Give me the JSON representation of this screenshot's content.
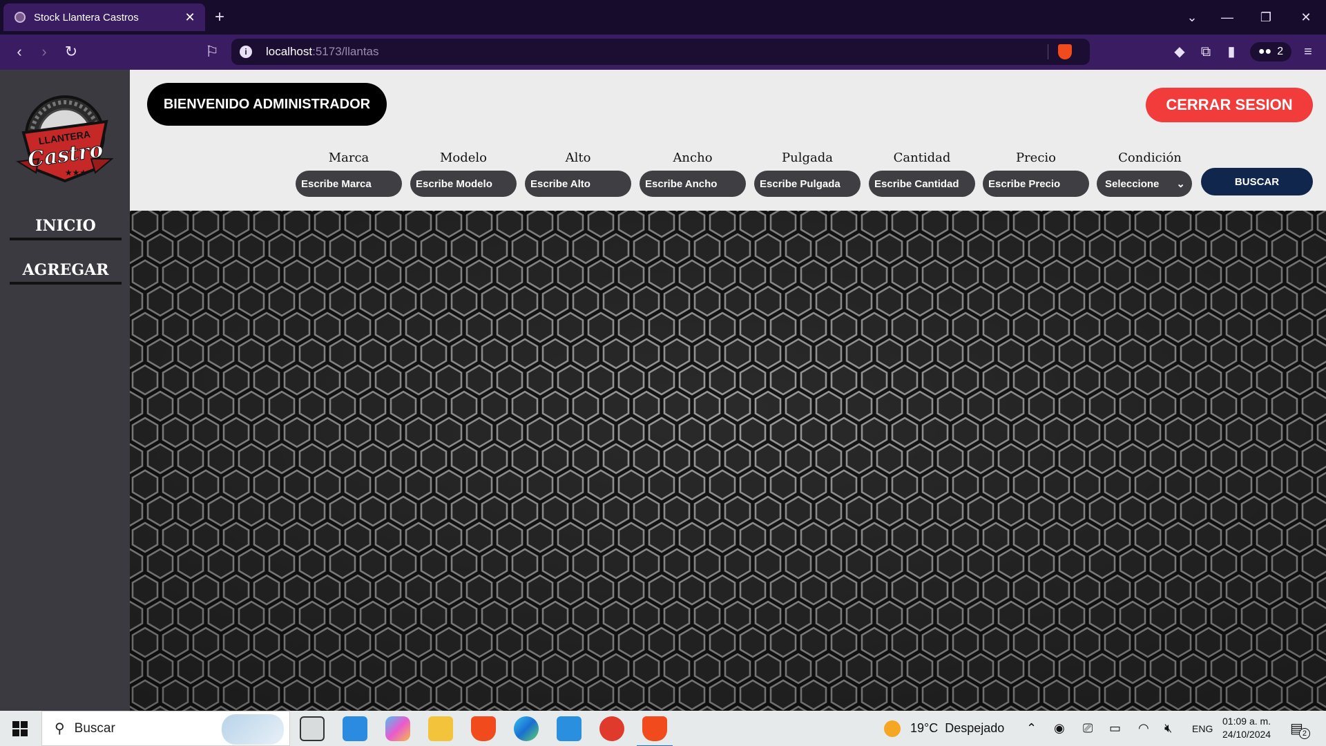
{
  "browser": {
    "tab_title": "Stock Llantera Castros",
    "tab_close": "✕",
    "new_tab": "+",
    "url_host": "localhost",
    "url_path": ":5173/llantas",
    "wallet_count": "2"
  },
  "sidebar": {
    "logo_top_text": "LLANTERA",
    "logo_script_text": "Castro",
    "logo_stars": "★★★",
    "items": [
      {
        "label": "INICIO"
      },
      {
        "label": "AGREGAR"
      }
    ]
  },
  "header": {
    "welcome": "BIENVENIDO ADMINISTRADOR",
    "logout": "CERRAR SESION"
  },
  "filters": [
    {
      "label": "Marca",
      "placeholder": "Escribe Marca"
    },
    {
      "label": "Modelo",
      "placeholder": "Escribe Modelo"
    },
    {
      "label": "Alto",
      "placeholder": "Escribe Alto"
    },
    {
      "label": "Ancho",
      "placeholder": "Escribe Ancho"
    },
    {
      "label": "Pulgada",
      "placeholder": "Escribe Pulgada"
    },
    {
      "label": "Cantidad",
      "placeholder": "Escribe Cantidad"
    },
    {
      "label": "Precio",
      "placeholder": "Escribe Precio"
    }
  ],
  "condition": {
    "label": "Condición",
    "selected": "Seleccione"
  },
  "search_button": "BUSCAR",
  "taskbar": {
    "search_placeholder": "Buscar",
    "weather": "19°C  Despejado",
    "language": "ENG",
    "time": "01:09 a. m.",
    "date": "24/10/2024",
    "notification_count": "2"
  },
  "colors": {
    "accent_red": "#f23b3b",
    "search_navy": "#10264c",
    "sidebar": "#3a3a40",
    "browser_purple": "#3a1c63"
  }
}
